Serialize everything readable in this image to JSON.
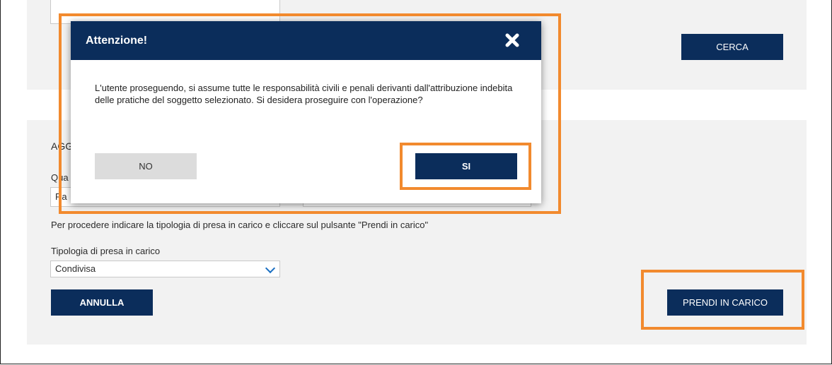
{
  "search": {
    "cerca_label": "CERCA"
  },
  "section": {
    "heading_partial": "AGG",
    "field_label_partial": "Qua",
    "field_value_partial": "Ra",
    "instruction": "Per procedere indicare la tipologia di presa in carico e cliccare sul pulsante \"Prendi in carico\"",
    "tipologia_label": "Tipologia di presa in carico",
    "tipologia_value": "Condivisa",
    "annulla_label": "ANNULLA",
    "prendi_label": "PRENDI IN CARICO"
  },
  "modal": {
    "title": "Attenzione!",
    "message": "L'utente proseguendo, si assume tutte le responsabilità civili e penali derivanti dall'attribuzione indebita delle pratiche del soggetto selezionato. Si desidera proseguire con l'operazione?",
    "no_label": "NO",
    "si_label": "SI",
    "close_icon": "close-x-icon"
  },
  "colors": {
    "primary": "#0b2d5b",
    "highlight": "#f28a2e",
    "panel_bg": "#f2f2f2"
  }
}
